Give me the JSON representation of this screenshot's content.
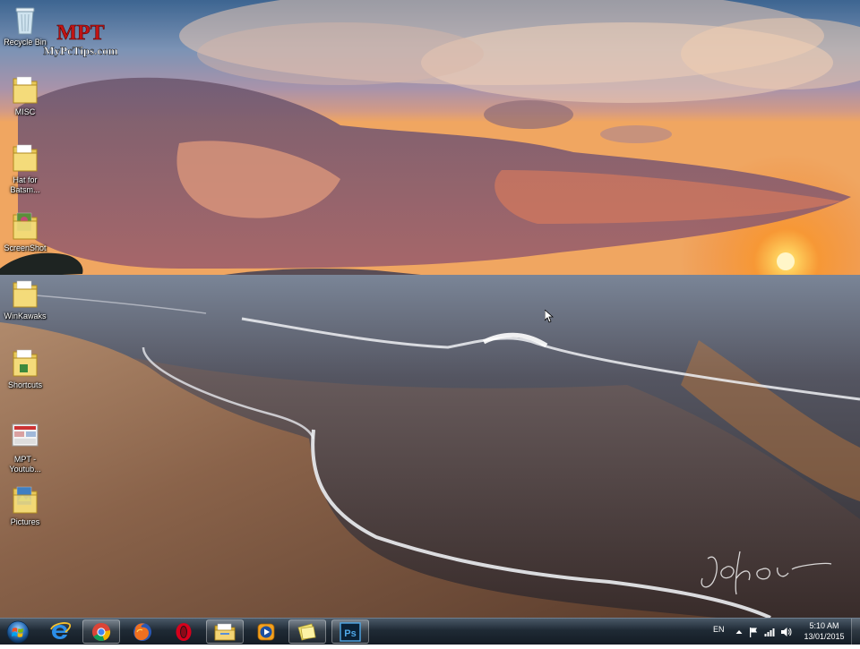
{
  "desktop": {
    "icons": [
      {
        "label": "Recycle Bin",
        "icon": "recycle-bin-icon"
      },
      {
        "label": "MISC",
        "icon": "folder-icon"
      },
      {
        "label": "Hat for Batsm...",
        "icon": "folder-icon"
      },
      {
        "label": "ScreenShot",
        "icon": "folder-icon"
      },
      {
        "label": "WinKawaks",
        "icon": "folder-icon"
      },
      {
        "label": "Shortcuts",
        "icon": "folder-icon"
      },
      {
        "label": "MPT - Youtub...",
        "icon": "document-icon"
      },
      {
        "label": "Pictures",
        "icon": "pictures-folder-icon"
      }
    ]
  },
  "watermark": {
    "brand": "MPT",
    "site": "MyPcTips.com"
  },
  "taskbar": {
    "start": "windows-orb-icon",
    "pinned": [
      {
        "name": "internet-explorer",
        "icon": "ie-icon",
        "active": false
      },
      {
        "name": "chrome",
        "icon": "chrome-icon",
        "active": true
      },
      {
        "name": "firefox",
        "icon": "firefox-icon",
        "active": false
      },
      {
        "name": "opera",
        "icon": "opera-icon",
        "active": false
      },
      {
        "name": "windows-explorer",
        "icon": "explorer-icon",
        "active": true
      },
      {
        "name": "media-player",
        "icon": "media-player-icon",
        "active": false
      },
      {
        "name": "sticky-notes",
        "icon": "sticky-notes-icon",
        "active": true
      },
      {
        "name": "photoshop",
        "icon": "photoshop-icon",
        "active": true,
        "text": "Ps"
      }
    ]
  },
  "tray": {
    "language": "EN",
    "time": "5:10 AM",
    "date": "13/01/2015"
  },
  "colors": {
    "sky_top": "#3f6a9a",
    "sunset": "#f7a640",
    "sea": "#5a5a66",
    "sand": "#7a5a44",
    "taskbar": "#1f2a35"
  }
}
